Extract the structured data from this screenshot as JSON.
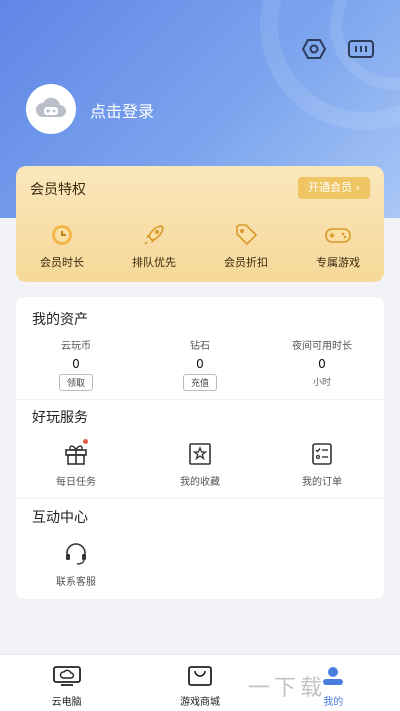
{
  "header": {
    "login_text": "点击登录",
    "icons": [
      "settings-icon",
      "message-icon"
    ]
  },
  "vip": {
    "title": "会员特权",
    "open_label": "开通会员",
    "items": [
      {
        "label": "会员时长",
        "icon": "clock-icon"
      },
      {
        "label": "排队优先",
        "icon": "rocket-icon"
      },
      {
        "label": "会员折扣",
        "icon": "tag-icon"
      },
      {
        "label": "专属游戏",
        "icon": "gamepad-icon"
      }
    ]
  },
  "assets": {
    "title": "我的资产",
    "items": [
      {
        "label": "云玩币",
        "value": "0",
        "action": "领取"
      },
      {
        "label": "钻石",
        "value": "0",
        "action": "充值"
      },
      {
        "label": "夜间可用时长",
        "value": "0",
        "unit": "小时"
      }
    ]
  },
  "services": {
    "title": "好玩服务",
    "items": [
      {
        "label": "每日任务",
        "icon": "gift-icon"
      },
      {
        "label": "我的收藏",
        "icon": "star-icon"
      },
      {
        "label": "我的订单",
        "icon": "order-icon"
      }
    ]
  },
  "interaction": {
    "title": "互动中心",
    "items": [
      {
        "label": "联系客服",
        "icon": "headset-icon"
      }
    ]
  },
  "tabbar": {
    "items": [
      {
        "label": "云电脑",
        "icon": "cloud-pc-icon"
      },
      {
        "label": "游戏商城",
        "icon": "shop-icon"
      },
      {
        "label": "我的",
        "icon": "profile-icon",
        "active": true
      }
    ]
  },
  "watermark": "一下载",
  "colors": {
    "accent": "#4a7de0",
    "vip_gold": "#f0c564",
    "header_blue": "#6b93e8"
  }
}
